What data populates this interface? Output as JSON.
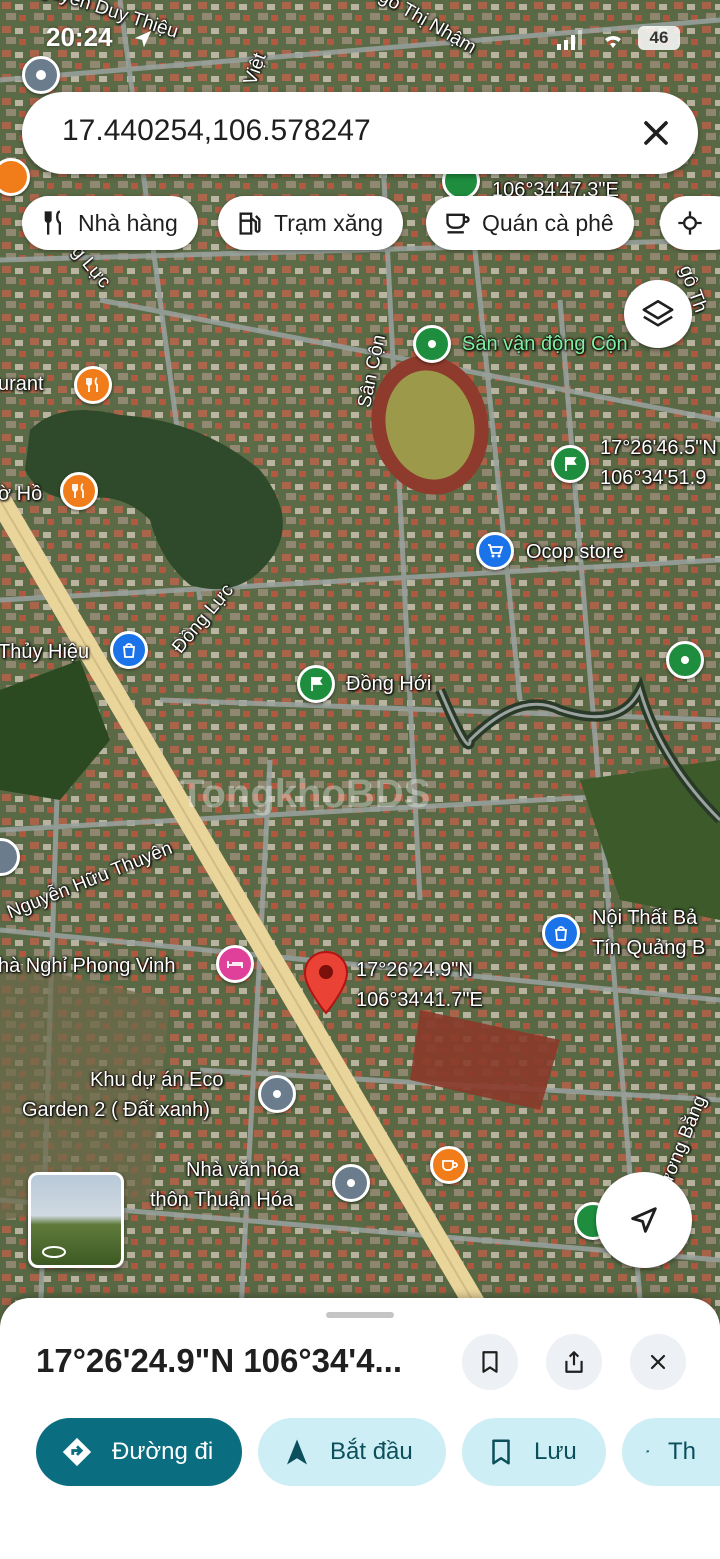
{
  "status_bar": {
    "time": "20:24",
    "battery": "46"
  },
  "search": {
    "query": "17.440254,106.578247"
  },
  "chips": [
    {
      "label": "Nhà hàng",
      "icon": "restaurant-icon"
    },
    {
      "label": "Trạm xăng",
      "icon": "gas-station-icon"
    },
    {
      "label": "Quán cà phê",
      "icon": "coffee-icon"
    }
  ],
  "map": {
    "streets": {
      "nguyen_duy_thieu": "Nguyễn Duy Thiệu",
      "ngo_thi_nham": "Ngô Thị Nhậm",
      "viet": "Việt",
      "dong_luc_top": "g Lực",
      "dong_luc": "Đồng Lực",
      "san_con": "Sân Cộn",
      "nguyen_huu_thuyen": "Nguyễn Hữu Thuyên",
      "duong_bang": "ương Bằng",
      "ngo_thi_right": "gô Th"
    },
    "places": {
      "restaurant": "urant",
      "ho": "ờ Hồ",
      "stadium": "Sân vận động Cộn",
      "coord_top_lat": "17°26'46.5\"N",
      "coord_top_lng": "106°34'51.9",
      "coord_mid_lng": "106°34'47.3\"E",
      "ocop": "Ocop store",
      "thuy_hieu": "Thủy Hiệu",
      "dong_hoi": "Đồng Hới",
      "noi_that_1": "Nội Thất Bả",
      "noi_that_2": "Tín Quảng B",
      "phong_vinh": "hà Nghỉ Phong Vinh",
      "pin_lat": "17°26'24.9\"N",
      "pin_lng": "106°34'41.7\"E",
      "eco_1": "Khu dự án Eco",
      "eco_2": "Garden 2 ( Đất xanh)",
      "nvh_1": "Nhà văn hóa",
      "nvh_2": "thôn Thuận Hóa"
    },
    "watermark": "TongkhoBDS"
  },
  "sheet": {
    "title": "17°26'24.9\"N 106°34'4...",
    "actions": [
      {
        "label": "Đường đi",
        "icon": "directions-icon"
      },
      {
        "label": "Bắt đầu",
        "icon": "navigation-icon"
      },
      {
        "label": "Lưu",
        "icon": "bookmark-icon"
      },
      {
        "label": "Th",
        "icon": "flag-icon"
      }
    ]
  },
  "colors": {
    "primary": "#0b6e80",
    "tonal": "#cdeef4",
    "pin_red": "#ea4335"
  }
}
